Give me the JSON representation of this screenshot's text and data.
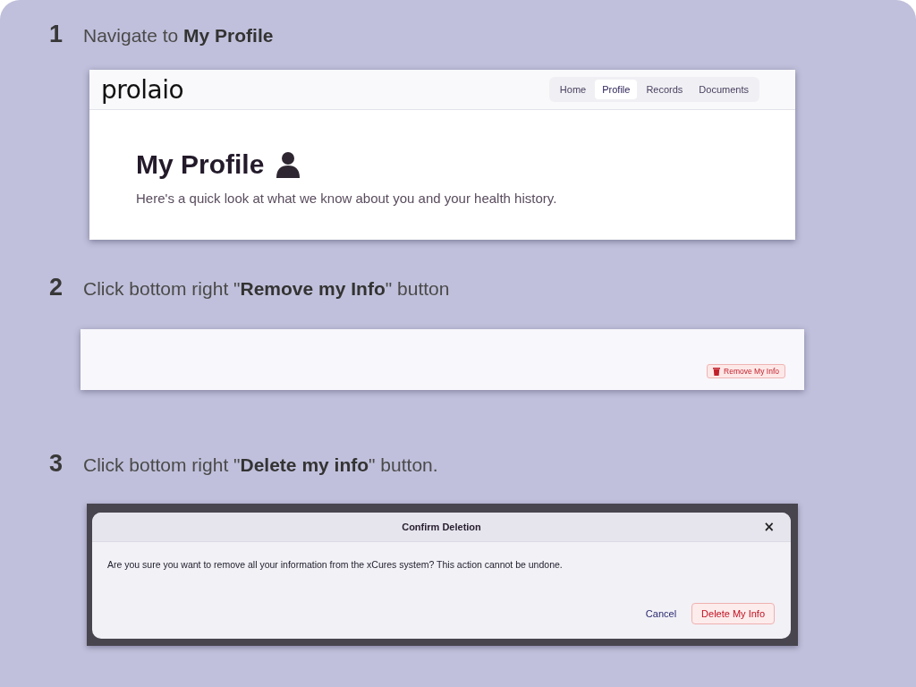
{
  "steps": [
    {
      "number": "1",
      "instruction": "Navigate to **My Profile**",
      "kind": "profile",
      "screen": {
        "logo": "prolaio",
        "nav": [
          {
            "label": "Home",
            "selected": false
          },
          {
            "label": "Profile",
            "selected": true
          },
          {
            "label": "Records",
            "selected": false
          },
          {
            "label": "Documents",
            "selected": false
          }
        ],
        "title": "My Profile",
        "subtitle": "Here's a quick look at what we know about you and your health history."
      }
    },
    {
      "number": "2",
      "instruction": "Click bottom right \"**Remove my Info**\" button",
      "kind": "button_bar",
      "screen": {
        "button": "Remove My Info"
      }
    },
    {
      "number": "3",
      "instruction": "Click bottom right \"**Delete my info**\" button.",
      "kind": "dialog",
      "screen": {
        "title": "Confirm Deletion",
        "close": "×",
        "message": "Are you sure you want to remove all your information from the xCures system? This action cannot be undone.",
        "buttons": [
          {
            "label": "Cancel",
            "kind": "secondary"
          },
          {
            "label": "Delete My Info",
            "kind": "danger"
          }
        ]
      }
    }
  ]
}
